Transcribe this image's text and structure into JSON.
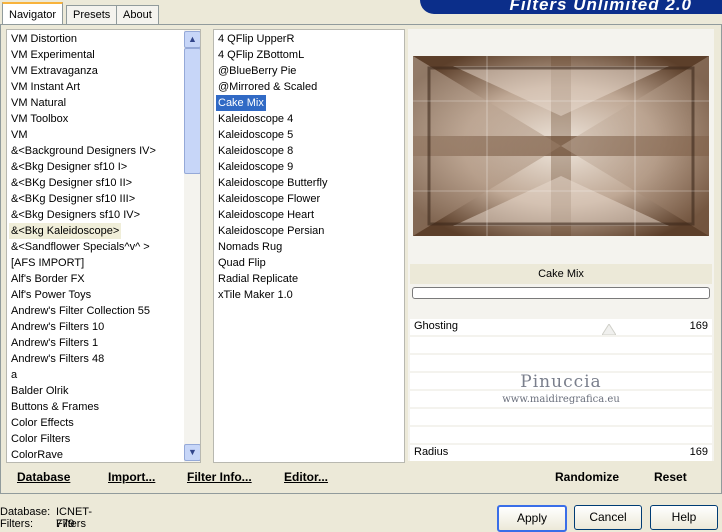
{
  "tabs": [
    {
      "label": "Navigator",
      "active": true
    },
    {
      "label": "Presets",
      "active": false
    },
    {
      "label": "About",
      "active": false
    }
  ],
  "banner": {
    "title": "Filters Unlimited 2.0"
  },
  "categories": {
    "items": [
      "VM Distortion",
      "VM Experimental",
      "VM Extravaganza",
      "VM Instant Art",
      "VM Natural",
      "VM Toolbox",
      "VM",
      "&<Background Designers IV>",
      "&<Bkg Designer sf10 I>",
      "&<BKg Designer sf10 II>",
      "&<BKg Designer sf10 III>",
      "&<Bkg Designers sf10 IV>",
      "&<Bkg Kaleidoscope>",
      "&<Sandflower Specials^v^ >",
      "[AFS IMPORT]",
      "Alf's Border FX",
      "Alf's Power Toys",
      "Andrew's Filter Collection 55",
      "Andrew's Filters 10",
      "Andrew's Filters 1",
      "Andrew's Filters 48",
      "a",
      "Balder Olrik",
      "Buttons & Frames",
      "Color Effects",
      "Color Filters",
      "ColorRave"
    ],
    "highlighted": "&<Bkg Kaleidoscope>"
  },
  "filters": {
    "items": [
      "4 QFlip UpperR",
      "4 QFlip ZBottomL",
      "@BlueBerry Pie",
      "@Mirrored & Scaled",
      "Cake Mix",
      "Kaleidoscope 4",
      "Kaleidoscope 5",
      "Kaleidoscope 8",
      "Kaleidoscope 9",
      "Kaleidoscope Butterfly",
      "Kaleidoscope Flower",
      "Kaleidoscope Heart",
      "Kaleidoscope Persian",
      "Nomads Rug",
      "Quad Flip",
      "Radial Replicate",
      "xTile Maker 1.0"
    ],
    "selected": "Cake Mix"
  },
  "preview": {
    "filter_name": "Cake Mix",
    "progress": 0
  },
  "params": [
    {
      "label": "Ghosting",
      "value": "169"
    },
    {
      "label": "Radius",
      "value": "169"
    }
  ],
  "watermark": {
    "name": "Pinuccia",
    "url": "www.maidiregrafica.eu"
  },
  "bottom_left": {
    "database": "Database",
    "import": "Import...",
    "filter_info": "Filter Info...",
    "editor": "Editor..."
  },
  "bottom_right": {
    "randomize": "Randomize",
    "reset": "Reset"
  },
  "status": {
    "database_label": "Database:",
    "database_value": "ICNET-Filters",
    "filters_label": "Filters:",
    "filters_value": "779"
  },
  "dialog_buttons": {
    "apply": "Apply",
    "cancel": "Cancel",
    "help": "Help"
  },
  "colors": {
    "selection": "#316ac5",
    "banner": "#0b2e8a"
  }
}
